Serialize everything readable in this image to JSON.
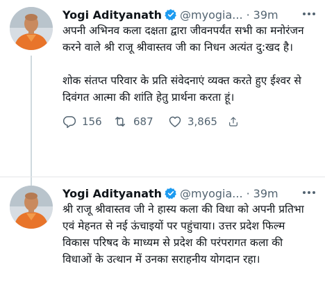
{
  "tweets": [
    {
      "author_name": "Yogi Adityanath",
      "handle": "@myogia...",
      "separator": "·",
      "time": "39m",
      "paragraphs": [
        "अपनी अभिनव कला दक्षता द्वारा जीवनपर्यंत सभी का मनोरंजन करने वाले श्री राजू श्रीवास्तव जी का निधन अत्यंत दु:खद है।",
        "शोक संतप्त परिवार के प्रति संवेदनाएं व्यक्त करते हुए ईश्वर से दिवंगत आत्मा की शांति हेतु प्रार्थना करता हूं।"
      ],
      "replies": "156",
      "retweets": "687",
      "likes": "3,865"
    },
    {
      "author_name": "Yogi Adityanath",
      "handle": "@myogia...",
      "separator": "·",
      "time": "39m",
      "paragraphs": [
        "श्री राजू श्रीवास्तव जी ने हास्य कला की विधा को अपनी प्रतिभा एवं मेहनत से नई ऊंचाइयों पर पहुंचाया। उत्तर प्रदेश फिल्म विकास परिषद के माध्यम से प्रदेश की परंपरागत कला की विधाओं के उत्थान में उनका सराहनीय योगदान रहा।"
      ]
    }
  ],
  "icons": {
    "verified": "verified-badge-icon",
    "more": "more-options-icon",
    "reply": "reply-icon",
    "retweet": "retweet-icon",
    "like": "like-icon",
    "share": "share-icon"
  },
  "colors": {
    "verified_blue": "#1d9bf0",
    "secondary_text": "#536471",
    "thread_line": "#cfd9de",
    "avatar_saffron": "#e8742a"
  }
}
